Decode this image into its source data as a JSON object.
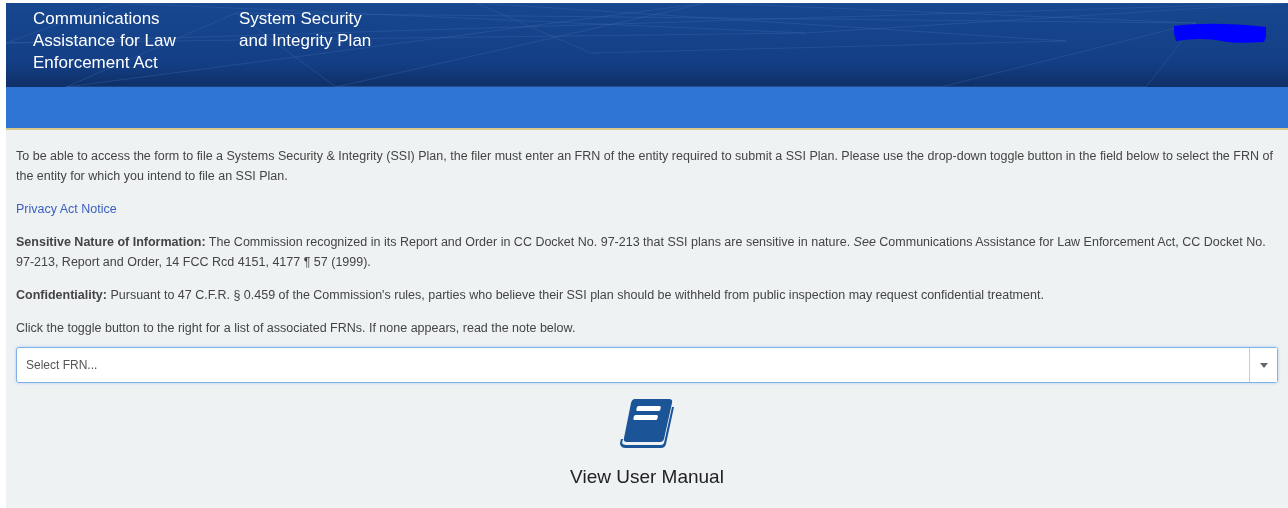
{
  "header": {
    "agency": "Communications Assistance for Law Enforcement Act",
    "title": "System Security and Integrity Plan",
    "redacted": true
  },
  "intro": "To be able to access the form to file a Systems Security & Integrity (SSI) Plan, the filer must enter an FRN of the entity required to submit a SSI Plan. Please use the drop-down toggle button in the field below to select the FRN of the entity for which you intend to file an SSI Plan.",
  "privacy_link": "Privacy Act Notice",
  "notices": [
    {
      "text": "**Sensitive Nature of Information:** The Commission recognized in its Report and Order in CC Docket No. 97-213 that SSI plans are sensitive in nature. *See* Communications Assistance for Law Enforcement Act, CC Docket No. 97-213, Report and Order, 14 FCC Rcd 4151, 4177 ¶ 57 (1999)."
    },
    {
      "text": "**Confidentiality:** Pursuant to 47 C.F.R. § 0.459 of the Commission's rules, parties who believe their SSI plan should be withheld from public inspection may request confidential treatment."
    },
    {
      "text": "Click the toggle button to the right for a list of associated FRNs. If none appears, read the note below."
    }
  ],
  "frn_select": {
    "placeholder": "Select FRN..."
  },
  "manual_link": "View User Manual"
}
